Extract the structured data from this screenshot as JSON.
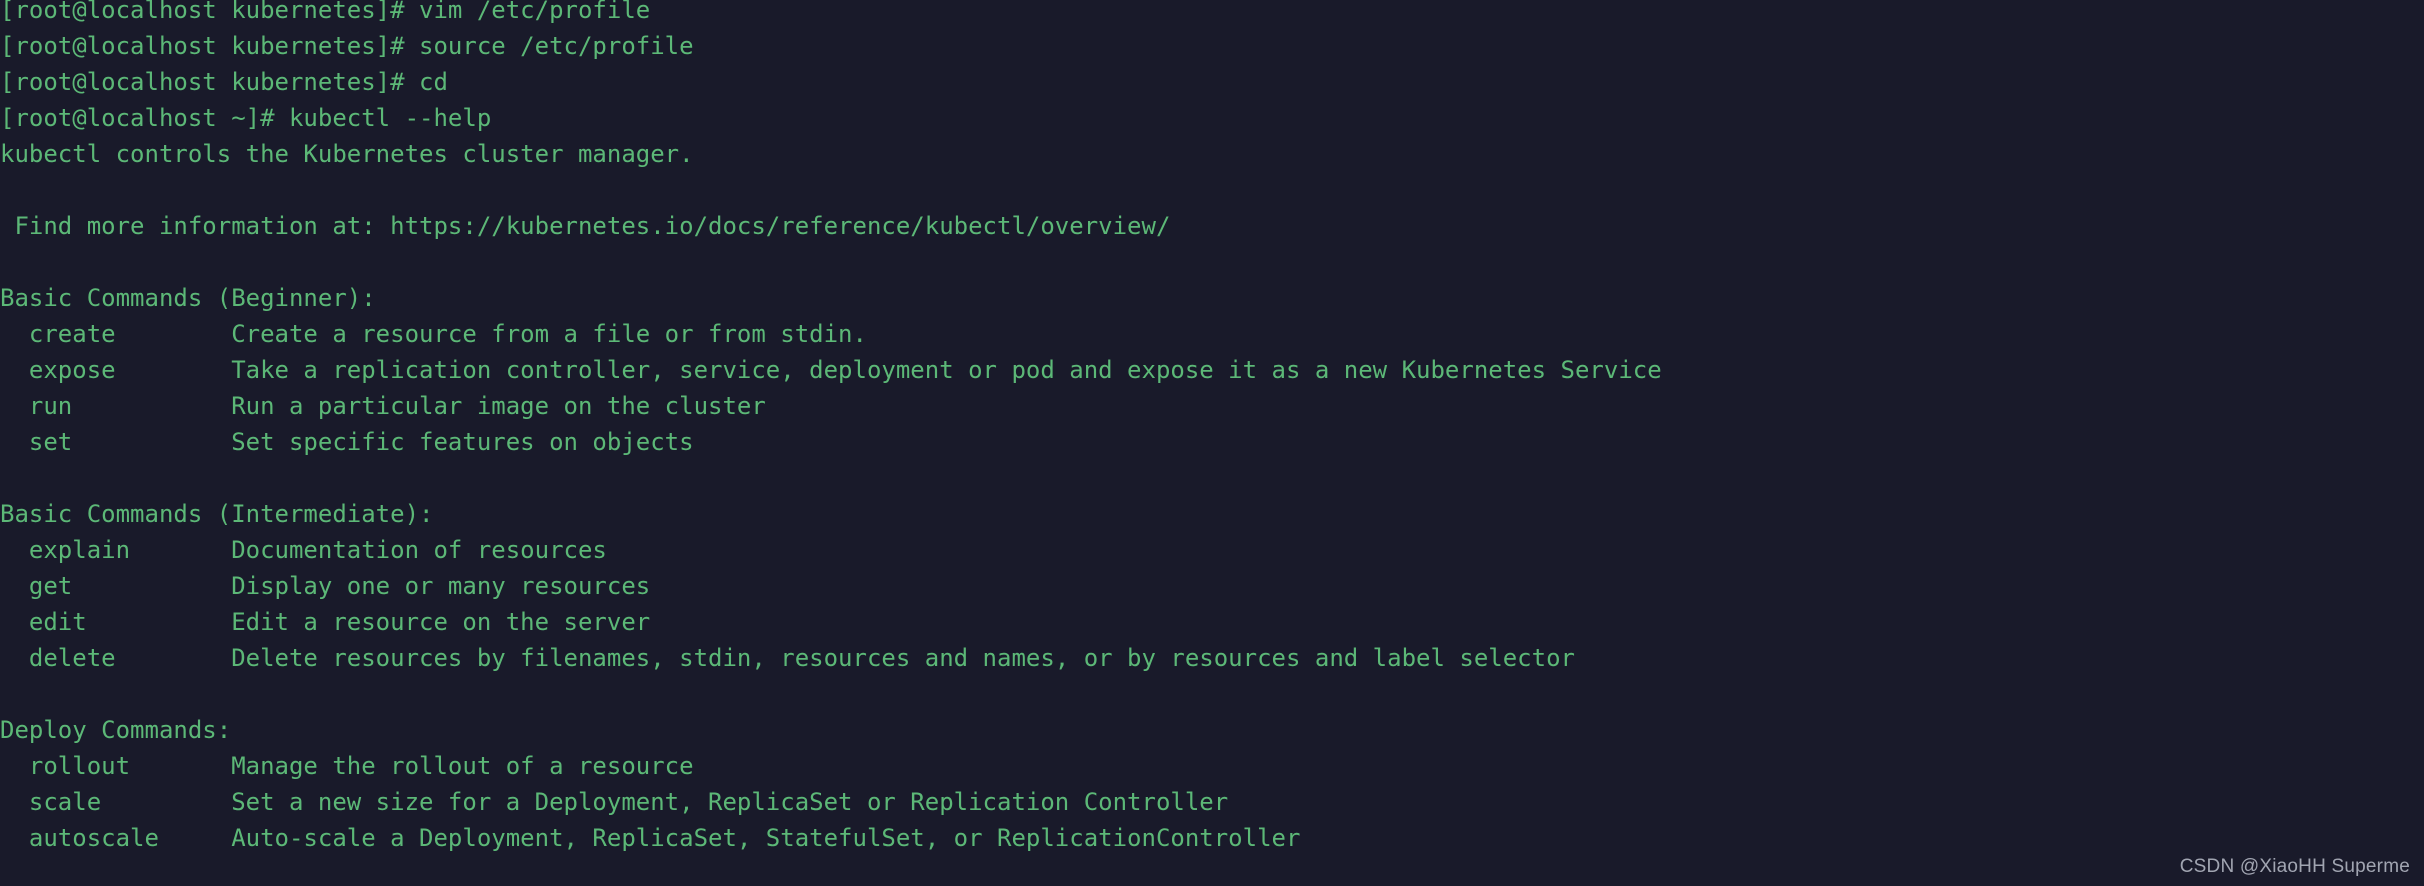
{
  "terminal": {
    "background_color": "#191a2a",
    "text_color": "#5cb877",
    "prompt_host": "[root@localhost kubernetes]#",
    "prompt_home": "[root@localhost ~]#",
    "lines": [
      "[root@localhost kubernetes]# vim /etc/profile",
      "[root@localhost kubernetes]# source /etc/profile",
      "[root@localhost kubernetes]# cd",
      "[root@localhost ~]# kubectl --help",
      "kubectl controls the Kubernetes cluster manager.",
      "",
      " Find more information at: https://kubernetes.io/docs/reference/kubectl/overview/",
      "",
      "Basic Commands (Beginner):",
      "  create        Create a resource from a file or from stdin.",
      "  expose        Take a replication controller, service, deployment or pod and expose it as a new Kubernetes Service",
      "  run           Run a particular image on the cluster",
      "  set           Set specific features on objects",
      "",
      "Basic Commands (Intermediate):",
      "  explain       Documentation of resources",
      "  get           Display one or many resources",
      "  edit          Edit a resource on the server",
      "  delete        Delete resources by filenames, stdin, resources and names, or by resources and label selector",
      "",
      "Deploy Commands:",
      "  rollout       Manage the rollout of a resource",
      "  scale         Set a new size for a Deployment, ReplicaSet or Replication Controller",
      "  autoscale     Auto-scale a Deployment, ReplicaSet, StatefulSet, or ReplicationController"
    ],
    "commands_typed": [
      "vim /etc/profile",
      "source /etc/profile",
      "cd",
      "kubectl --help"
    ],
    "description": "kubectl controls the Kubernetes cluster manager.",
    "info_label": "Find more information at:",
    "info_url": "https://kubernetes.io/docs/reference/kubectl/overview/",
    "sections": [
      {
        "heading": "Basic Commands (Beginner):",
        "commands": [
          {
            "name": "create",
            "description": "Create a resource from a file or from stdin."
          },
          {
            "name": "expose",
            "description": "Take a replication controller, service, deployment or pod and expose it as a new Kubernetes Service"
          },
          {
            "name": "run",
            "description": "Run a particular image on the cluster"
          },
          {
            "name": "set",
            "description": "Set specific features on objects"
          }
        ]
      },
      {
        "heading": "Basic Commands (Intermediate):",
        "commands": [
          {
            "name": "explain",
            "description": "Documentation of resources"
          },
          {
            "name": "get",
            "description": "Display one or many resources"
          },
          {
            "name": "edit",
            "description": "Edit a resource on the server"
          },
          {
            "name": "delete",
            "description": "Delete resources by filenames, stdin, resources and names, or by resources and label selector"
          }
        ]
      },
      {
        "heading": "Deploy Commands:",
        "commands": [
          {
            "name": "rollout",
            "description": "Manage the rollout of a resource"
          },
          {
            "name": "scale",
            "description": "Set a new size for a Deployment, ReplicaSet or Replication Controller"
          },
          {
            "name": "autoscale",
            "description": "Auto-scale a Deployment, ReplicaSet, StatefulSet, or ReplicationController"
          }
        ]
      }
    ]
  },
  "watermark": {
    "text": "CSDN @XiaoHH Superme"
  }
}
